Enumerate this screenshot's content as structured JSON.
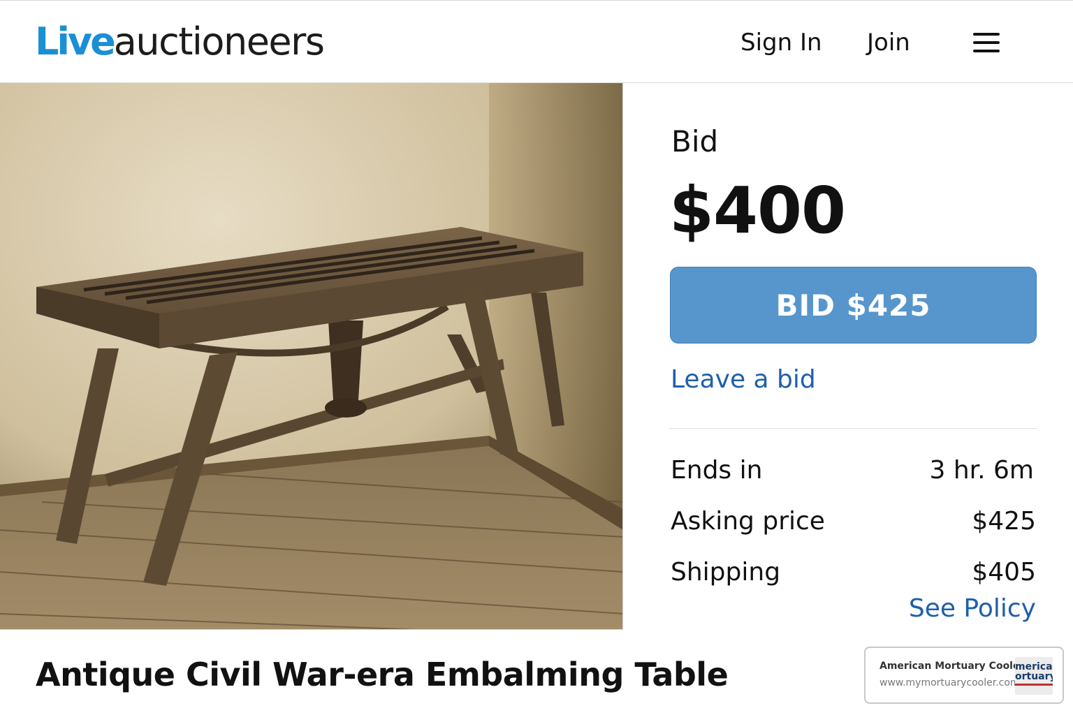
{
  "header": {
    "logo_live": "Live",
    "logo_rest": "auctioneers",
    "sign_in": "Sign In",
    "join": "Join",
    "menu_icon": "hamburger-menu-icon"
  },
  "product": {
    "image_icon": "wooden-table-photo",
    "title": "Antique Civil War-era Embalming Table"
  },
  "bid_panel": {
    "label": "Bid",
    "current_bid": "$400",
    "bid_button": "BID $425",
    "leave_bid": "Leave a bid",
    "rows": [
      {
        "label": "Ends in",
        "value": "3 hr. 6m"
      },
      {
        "label": "Asking price",
        "value": "$425"
      },
      {
        "label": "Shipping",
        "value": "$405"
      }
    ],
    "see_policy": "See Policy"
  },
  "ad": {
    "name": "American Mortuary Coolers",
    "url": "www.mymortuarycooler.com",
    "thumb_line1": "merican",
    "thumb_line2": "ortuary"
  },
  "colors": {
    "brand_blue": "#1a8fd6",
    "button_blue": "#5696cc",
    "link_blue": "#1e5fab"
  }
}
